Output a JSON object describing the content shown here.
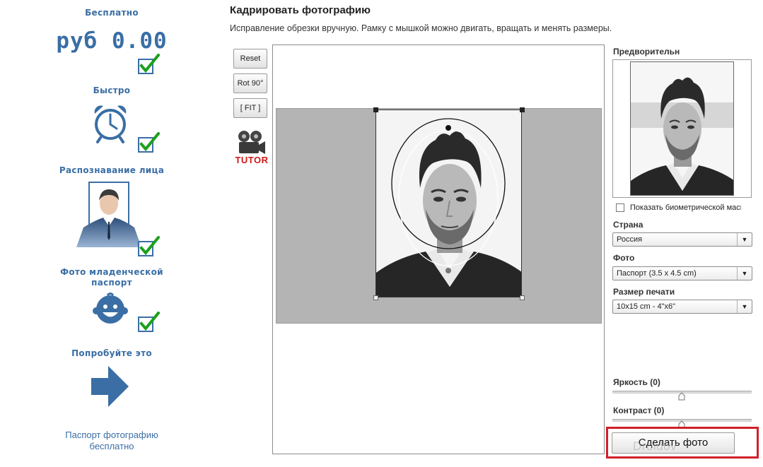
{
  "sidebar": {
    "free_heading": "Бесплатно",
    "price": "руб 0.00",
    "fast_heading": "Быстро",
    "face_heading": "Распознавание лица",
    "baby_heading": "Фото младенческой паспорт",
    "try_heading": "Попробуйте это",
    "footer_text": "Паспорт фотографию бесплатно"
  },
  "header": {
    "title": "Кадрировать фотографию",
    "subtitle": "Исправление обрезки вручную. Рамку с мышкой можно двигать, вращать и менять размеры."
  },
  "tools": {
    "reset_label": "Reset",
    "rotate_label": "Rot 90°",
    "fit_label": "[ FIT ]",
    "tutor_label": "TUTOR"
  },
  "panel": {
    "preview_label": "Предворительн",
    "biometric_label": "Показать биометрической маски",
    "country_label": "Страна",
    "country_value": "Россия",
    "photo_label": "Фото",
    "photo_value": "Паспорт (3.5 x 4.5 cm)",
    "print_label": "Размер печати",
    "print_value": "10x15 cm - 4\"x6\"",
    "brightness_label": "Яркость (0)",
    "contrast_label": "Контраст (0)",
    "make_photo_label": "Сделать фото",
    "watermark": "Droidov"
  },
  "colors": {
    "accent": "#3a6ea5",
    "check": "#1aa01a",
    "highlight": "#d0202a",
    "tutor": "#d01818"
  }
}
